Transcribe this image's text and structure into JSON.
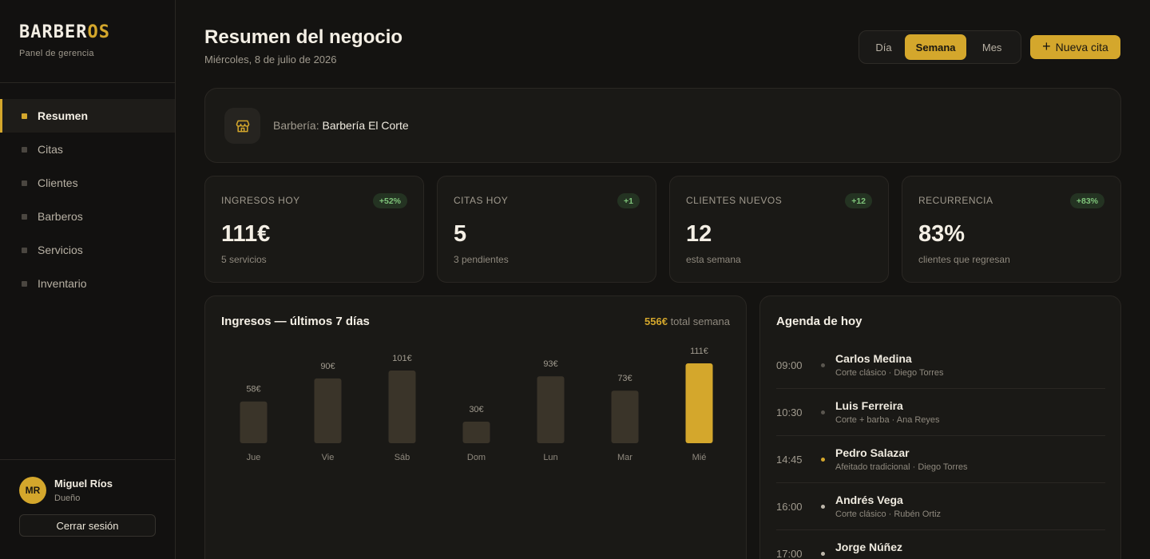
{
  "brand": {
    "logo_main": "BARBER",
    "logo_accent": "OS",
    "subtitle": "Panel de gerencia"
  },
  "nav": {
    "items": [
      {
        "label": "Resumen",
        "active": true
      },
      {
        "label": "Citas",
        "active": false
      },
      {
        "label": "Clientes",
        "active": false
      },
      {
        "label": "Barberos",
        "active": false
      },
      {
        "label": "Servicios",
        "active": false
      },
      {
        "label": "Inventario",
        "active": false
      }
    ]
  },
  "user": {
    "initials": "MR",
    "name": "Miguel Ríos",
    "role": "Dueño",
    "logout_label": "Cerrar sesión"
  },
  "header": {
    "title": "Resumen del negocio",
    "date": "Miércoles, 8 de julio de 2026",
    "periods": [
      "Día",
      "Semana",
      "Mes"
    ],
    "selected_period": "Semana",
    "new_button": "Nueva cita"
  },
  "shop": {
    "label": "Barbería:",
    "name": "Barbería El Corte",
    "icon": "store-icon"
  },
  "kpis": [
    {
      "label": "INGRESOS HOY",
      "badge": "+52%",
      "value": "111€",
      "sub": "5 servicios"
    },
    {
      "label": "CITAS HOY",
      "badge": "+1",
      "value": "5",
      "sub": "3 pendientes"
    },
    {
      "label": "CLIENTES NUEVOS",
      "badge": "+12",
      "value": "12",
      "sub": "esta semana"
    },
    {
      "label": "RECURRENCIA",
      "badge": "+83%",
      "value": "83%",
      "sub": "clientes que regresan"
    }
  ],
  "chart": {
    "title": "Ingresos — últimos 7 días",
    "total_amount": "556€",
    "total_label": "total semana"
  },
  "chart_data": {
    "type": "bar",
    "title": "Ingresos — últimos 7 días",
    "categories": [
      "Jue",
      "Vie",
      "Sáb",
      "Dom",
      "Lun",
      "Mar",
      "Mié"
    ],
    "values": [
      58,
      90,
      101,
      30,
      93,
      73,
      111
    ],
    "data_labels": [
      "58€",
      "90€",
      "101€",
      "30€",
      "93€",
      "73€",
      "111€"
    ],
    "highlight_index": 6,
    "colors": {
      "bar": "#3a3429",
      "highlight": "#d4a72c"
    },
    "grid": false
  },
  "agenda": {
    "title": "Agenda de hoy",
    "items": [
      {
        "time": "09:00",
        "name": "Carlos Medina",
        "desc": "Corte clásico · Diego Torres",
        "status": "done"
      },
      {
        "time": "10:30",
        "name": "Luis Ferreira",
        "desc": "Corte + barba · Ana Reyes",
        "status": "done"
      },
      {
        "time": "14:45",
        "name": "Pedro Salazar",
        "desc": "Afeitado tradicional · Diego Torres",
        "status": "current"
      },
      {
        "time": "16:00",
        "name": "Andrés Vega",
        "desc": "Corte clásico · Rubén Ortiz",
        "status": "pending"
      },
      {
        "time": "17:00",
        "name": "Jorge Núñez",
        "desc": "",
        "status": "pending"
      }
    ]
  },
  "colors": {
    "accent": "#d4a72c",
    "background": "#141311",
    "card": "#1a1916",
    "positive": "#7fc47a"
  }
}
